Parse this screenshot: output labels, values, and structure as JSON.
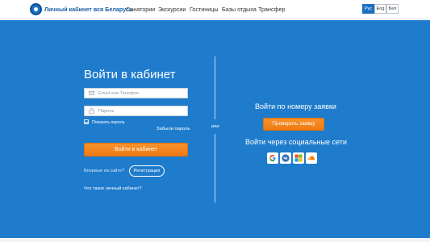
{
  "header": {
    "brand": "Личный кабинет вся Беларусь",
    "nav": [
      "Санатории",
      "Экскурсии",
      "Гостиницы",
      "Базы отдыха",
      "Трансфер"
    ],
    "languages": [
      "Рус",
      "Eng",
      "Бел"
    ],
    "active_language": "Рус"
  },
  "login": {
    "title": "Войти в кабинет",
    "email_placeholder": "Email или Телефон",
    "password_placeholder": "Пароль",
    "show_password": "Показать пароль",
    "forgot": "Забыли пароль",
    "submit": "Войти в кабинет",
    "first_time": "Впервые на сайте?",
    "register": "Регистрация",
    "what_is": "Что такое личный кабинет?"
  },
  "divider": {
    "or": "или"
  },
  "request": {
    "title": "Войти по номеру заявки",
    "button": "Проверить заявку"
  },
  "social": {
    "title": "Войти через социальные сети",
    "providers": [
      "google-icon",
      "vk-icon",
      "microsoft-icon",
      "soundcloud-icon"
    ]
  },
  "colors": {
    "primary": "#1f7ccd",
    "accent": "#f7891f",
    "brand": "#1a5fa8"
  }
}
